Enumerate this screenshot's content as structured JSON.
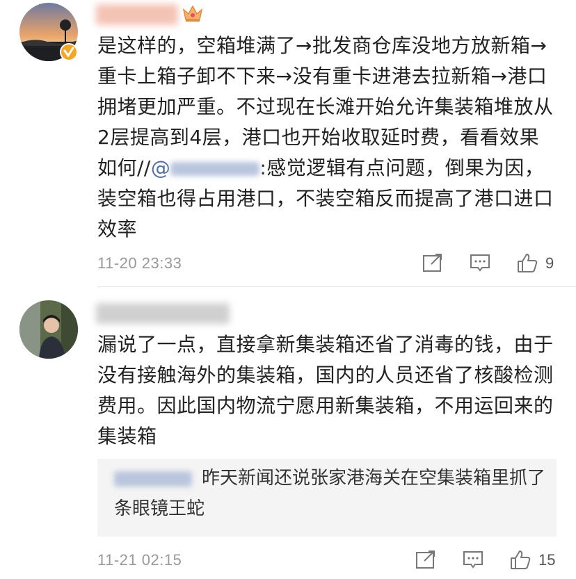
{
  "comments": [
    {
      "text_before_mention": "是这样的，空箱堆满了→批发商仓库没地方放新箱→重卡上箱子卸不下来→没有重卡进港去拉新箱→港口拥堵更加严重。不过现在长滩开始允许集装箱堆放从2层提高到4层，港口也开始收取延时费，看看效果如何//",
      "mention_at": "@",
      "text_after_mention": ":感觉逻辑有点问题，倒果为因，装空箱也得占用港口，不装空箱反而提高了港口进口效率",
      "time": "11-20 23:33",
      "likes": "9",
      "badges": [
        "crown-icon",
        "verified-icon"
      ]
    },
    {
      "text": "漏说了一点，直接拿新集装箱还省了消毒的钱，由于没有接触海外的集装箱，国内的人员还省了核酸检测费用。因此国内物流宁愿用新集装箱，不用运回来的集装箱",
      "reply_text": "昨天新闻还说张家港海关在空集装箱里抓了条眼镜王蛇",
      "time": "11-21 02:15",
      "likes": "15"
    }
  ],
  "colors": {
    "mention": "#4d6eaa",
    "meta": "#999999",
    "reply_bg": "#f4f4f4",
    "verified": "#f5a623"
  }
}
